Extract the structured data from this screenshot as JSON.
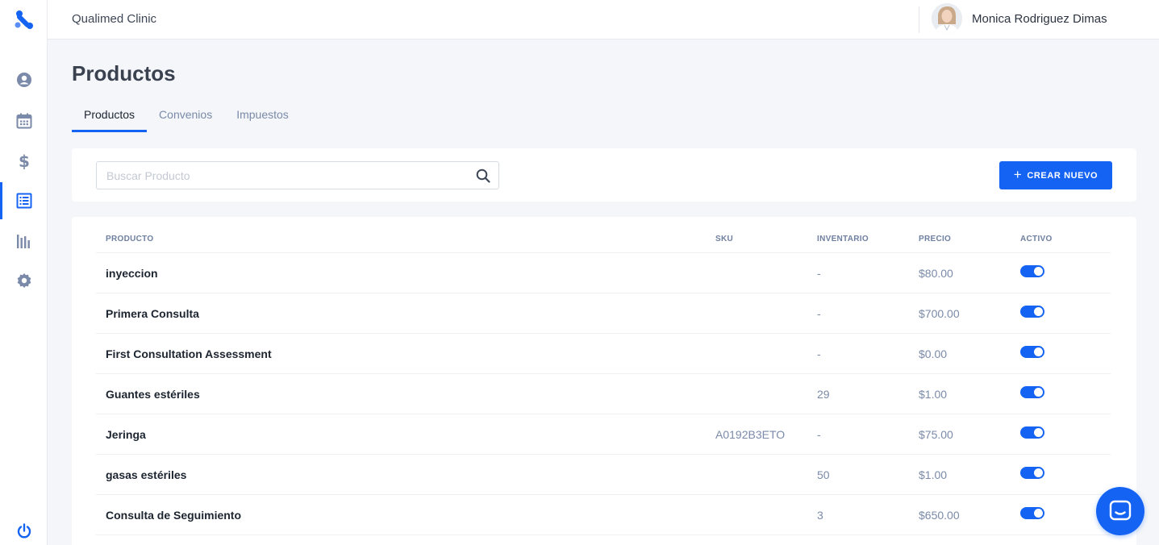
{
  "topbar": {
    "clinic_name": "Qualimed Clinic",
    "user_name": "Monica Rodriguez Dimas"
  },
  "sidebar": {
    "items": [
      {
        "icon": "user-circle-icon"
      },
      {
        "icon": "calendar-icon"
      },
      {
        "icon": "dollar-icon"
      },
      {
        "icon": "list-icon",
        "active": true
      },
      {
        "icon": "bar-chart-icon"
      },
      {
        "icon": "gear-icon"
      }
    ],
    "bottom_icon": "power-icon"
  },
  "page": {
    "title": "Productos",
    "tabs": [
      {
        "label": "Productos",
        "active": true
      },
      {
        "label": "Convenios"
      },
      {
        "label": "Impuestos"
      }
    ]
  },
  "search": {
    "placeholder": "Buscar Producto",
    "value": ""
  },
  "actions": {
    "create_label": "CREAR NUEVO"
  },
  "table": {
    "headers": {
      "producto": "PRODUCTO",
      "sku": "SKU",
      "inventario": "INVENTARIO",
      "precio": "PRECIO",
      "activo": "ACTIVO"
    },
    "rows": [
      {
        "name": "inyeccion",
        "sku": "",
        "inventario": "-",
        "precio": "$80.00",
        "activo": true
      },
      {
        "name": "Primera Consulta",
        "sku": "",
        "inventario": "-",
        "precio": "$700.00",
        "activo": true
      },
      {
        "name": "First Consultation Assessment",
        "sku": "",
        "inventario": "-",
        "precio": "$0.00",
        "activo": true
      },
      {
        "name": "Guantes estériles",
        "sku": "",
        "inventario": "29",
        "precio": "$1.00",
        "activo": true
      },
      {
        "name": "Jeringa",
        "sku": "A0192B3ETO",
        "inventario": "-",
        "precio": "$75.00",
        "activo": true
      },
      {
        "name": "gasas estériles",
        "sku": "",
        "inventario": "50",
        "precio": "$1.00",
        "activo": true
      },
      {
        "name": "Consulta de Seguimiento",
        "sku": "",
        "inventario": "3",
        "precio": "$650.00",
        "activo": true
      }
    ]
  },
  "colors": {
    "accent": "#1463f3",
    "muted_text": "#7a8aa8",
    "background": "#f4f6f9"
  }
}
